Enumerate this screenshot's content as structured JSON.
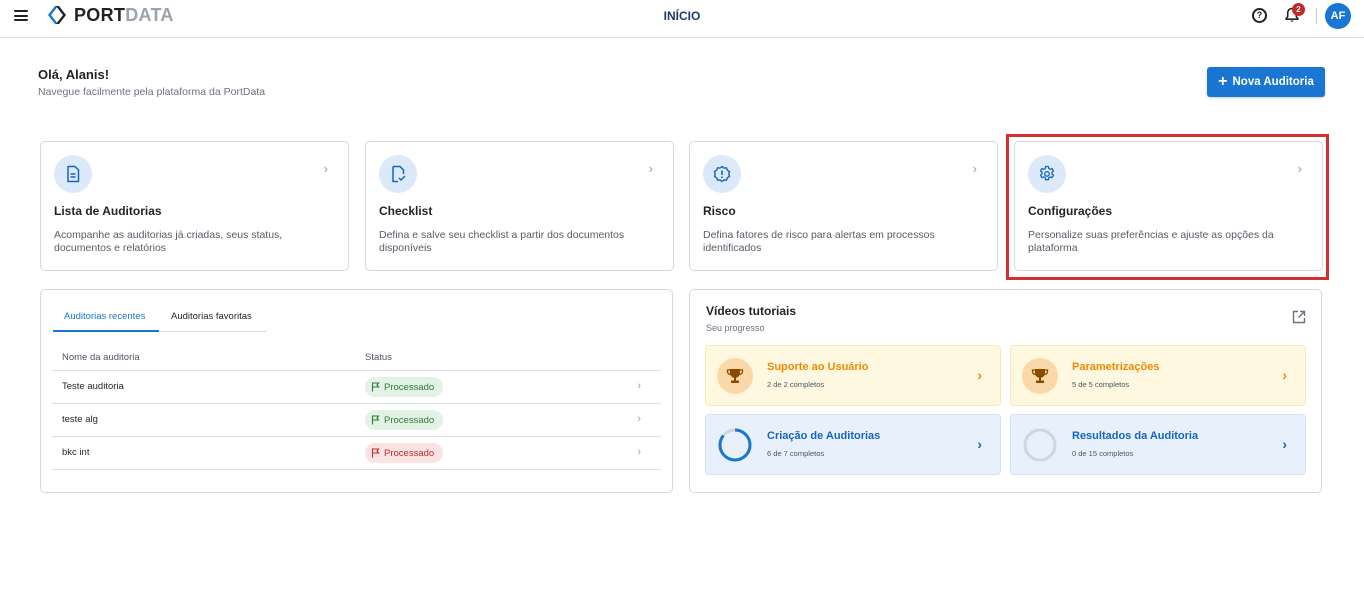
{
  "app": {
    "logo_text_a": "PORT",
    "logo_text_b": "DATA",
    "page_title": "INÍCIO"
  },
  "header": {
    "help_icon": "help-circle-icon",
    "notification_count": "2",
    "avatar_initials": "AF",
    "colors": {
      "accent": "#1976d2",
      "badge": "#c62828"
    }
  },
  "greeting": {
    "title": "Olá, Alanis!",
    "subtitle": "Navegue facilmente pela plataforma da PortData"
  },
  "new_audit_button": {
    "label": "Nova Auditoria"
  },
  "cards": [
    {
      "title": "Lista de Auditorias",
      "description": "Acompanhe as auditorias já criadas, seus status, documentos e relatórios",
      "icon": "document-list-icon"
    },
    {
      "title": "Checklist",
      "description": "Defina e salve seu checklist a partir dos documentos disponíveis",
      "icon": "checklist-document-icon"
    },
    {
      "title": "Risco",
      "description": "Defina fatores de risco para alertas em processos identificados",
      "icon": "alert-badge-icon"
    },
    {
      "title": "Configurações",
      "description": "Personalize suas preferências e ajuste as opções da plataforma",
      "icon": "gear-icon"
    }
  ],
  "audits": {
    "tabs": [
      "Auditorias recentes",
      "Auditorias favoritas"
    ],
    "columns": [
      "Nome da auditoria",
      "Status"
    ],
    "rows": [
      {
        "name": "Teste auditoria",
        "status": "Processado",
        "state": "success"
      },
      {
        "name": "teste alg",
        "status": "Processado",
        "state": "success"
      },
      {
        "name": "bkc int",
        "status": "Processado",
        "state": "error"
      }
    ]
  },
  "tutorials": {
    "title": "Vídeos tutoriais",
    "subtitle": "Seu progresso",
    "items": [
      {
        "title": "Suporte ao Usuário",
        "progress_text": "2 de 2 completos",
        "done": 2,
        "total": 2,
        "icon": "trophy-icon"
      },
      {
        "title": "Parametrizações",
        "progress_text": "5 de 5 completos",
        "done": 5,
        "total": 5,
        "icon": "trophy-icon"
      },
      {
        "title": "Criação de Auditorias",
        "progress_text": "6 de 7 completos",
        "done": 6,
        "total": 7,
        "icon": "progress-ring-icon"
      },
      {
        "title": "Resultados da Auditoria",
        "progress_text": "0 de 15 completos",
        "done": 0,
        "total": 15,
        "icon": "progress-ring-icon"
      }
    ]
  }
}
